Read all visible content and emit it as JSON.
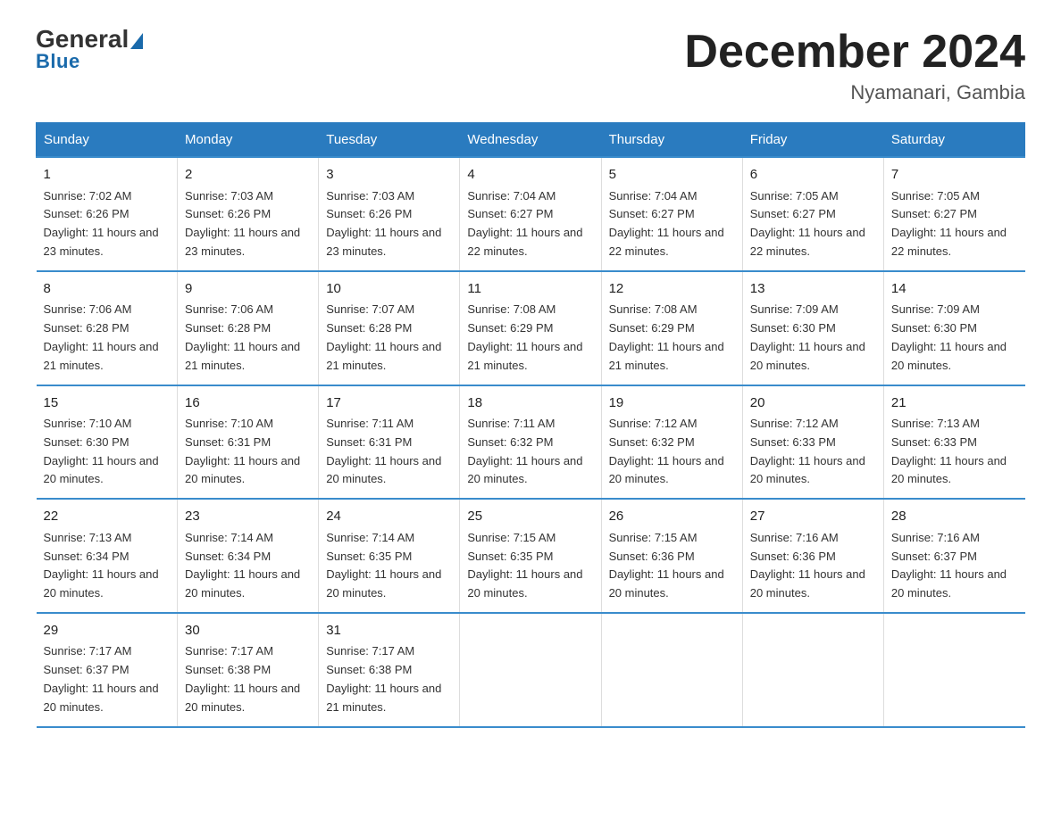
{
  "header": {
    "logo_general": "General",
    "logo_blue": "Blue",
    "month_title": "December 2024",
    "location": "Nyamanari, Gambia"
  },
  "weekdays": [
    "Sunday",
    "Monday",
    "Tuesday",
    "Wednesday",
    "Thursday",
    "Friday",
    "Saturday"
  ],
  "weeks": [
    [
      {
        "day": "1",
        "sunrise": "7:02 AM",
        "sunset": "6:26 PM",
        "daylight": "11 hours and 23 minutes."
      },
      {
        "day": "2",
        "sunrise": "7:03 AM",
        "sunset": "6:26 PM",
        "daylight": "11 hours and 23 minutes."
      },
      {
        "day": "3",
        "sunrise": "7:03 AM",
        "sunset": "6:26 PM",
        "daylight": "11 hours and 23 minutes."
      },
      {
        "day": "4",
        "sunrise": "7:04 AM",
        "sunset": "6:27 PM",
        "daylight": "11 hours and 22 minutes."
      },
      {
        "day": "5",
        "sunrise": "7:04 AM",
        "sunset": "6:27 PM",
        "daylight": "11 hours and 22 minutes."
      },
      {
        "day": "6",
        "sunrise": "7:05 AM",
        "sunset": "6:27 PM",
        "daylight": "11 hours and 22 minutes."
      },
      {
        "day": "7",
        "sunrise": "7:05 AM",
        "sunset": "6:27 PM",
        "daylight": "11 hours and 22 minutes."
      }
    ],
    [
      {
        "day": "8",
        "sunrise": "7:06 AM",
        "sunset": "6:28 PM",
        "daylight": "11 hours and 21 minutes."
      },
      {
        "day": "9",
        "sunrise": "7:06 AM",
        "sunset": "6:28 PM",
        "daylight": "11 hours and 21 minutes."
      },
      {
        "day": "10",
        "sunrise": "7:07 AM",
        "sunset": "6:28 PM",
        "daylight": "11 hours and 21 minutes."
      },
      {
        "day": "11",
        "sunrise": "7:08 AM",
        "sunset": "6:29 PM",
        "daylight": "11 hours and 21 minutes."
      },
      {
        "day": "12",
        "sunrise": "7:08 AM",
        "sunset": "6:29 PM",
        "daylight": "11 hours and 21 minutes."
      },
      {
        "day": "13",
        "sunrise": "7:09 AM",
        "sunset": "6:30 PM",
        "daylight": "11 hours and 20 minutes."
      },
      {
        "day": "14",
        "sunrise": "7:09 AM",
        "sunset": "6:30 PM",
        "daylight": "11 hours and 20 minutes."
      }
    ],
    [
      {
        "day": "15",
        "sunrise": "7:10 AM",
        "sunset": "6:30 PM",
        "daylight": "11 hours and 20 minutes."
      },
      {
        "day": "16",
        "sunrise": "7:10 AM",
        "sunset": "6:31 PM",
        "daylight": "11 hours and 20 minutes."
      },
      {
        "day": "17",
        "sunrise": "7:11 AM",
        "sunset": "6:31 PM",
        "daylight": "11 hours and 20 minutes."
      },
      {
        "day": "18",
        "sunrise": "7:11 AM",
        "sunset": "6:32 PM",
        "daylight": "11 hours and 20 minutes."
      },
      {
        "day": "19",
        "sunrise": "7:12 AM",
        "sunset": "6:32 PM",
        "daylight": "11 hours and 20 minutes."
      },
      {
        "day": "20",
        "sunrise": "7:12 AM",
        "sunset": "6:33 PM",
        "daylight": "11 hours and 20 minutes."
      },
      {
        "day": "21",
        "sunrise": "7:13 AM",
        "sunset": "6:33 PM",
        "daylight": "11 hours and 20 minutes."
      }
    ],
    [
      {
        "day": "22",
        "sunrise": "7:13 AM",
        "sunset": "6:34 PM",
        "daylight": "11 hours and 20 minutes."
      },
      {
        "day": "23",
        "sunrise": "7:14 AM",
        "sunset": "6:34 PM",
        "daylight": "11 hours and 20 minutes."
      },
      {
        "day": "24",
        "sunrise": "7:14 AM",
        "sunset": "6:35 PM",
        "daylight": "11 hours and 20 minutes."
      },
      {
        "day": "25",
        "sunrise": "7:15 AM",
        "sunset": "6:35 PM",
        "daylight": "11 hours and 20 minutes."
      },
      {
        "day": "26",
        "sunrise": "7:15 AM",
        "sunset": "6:36 PM",
        "daylight": "11 hours and 20 minutes."
      },
      {
        "day": "27",
        "sunrise": "7:16 AM",
        "sunset": "6:36 PM",
        "daylight": "11 hours and 20 minutes."
      },
      {
        "day": "28",
        "sunrise": "7:16 AM",
        "sunset": "6:37 PM",
        "daylight": "11 hours and 20 minutes."
      }
    ],
    [
      {
        "day": "29",
        "sunrise": "7:17 AM",
        "sunset": "6:37 PM",
        "daylight": "11 hours and 20 minutes."
      },
      {
        "day": "30",
        "sunrise": "7:17 AM",
        "sunset": "6:38 PM",
        "daylight": "11 hours and 20 minutes."
      },
      {
        "day": "31",
        "sunrise": "7:17 AM",
        "sunset": "6:38 PM",
        "daylight": "11 hours and 21 minutes."
      },
      null,
      null,
      null,
      null
    ]
  ],
  "labels": {
    "sunrise": "Sunrise: ",
    "sunset": "Sunset: ",
    "daylight": "Daylight: "
  }
}
